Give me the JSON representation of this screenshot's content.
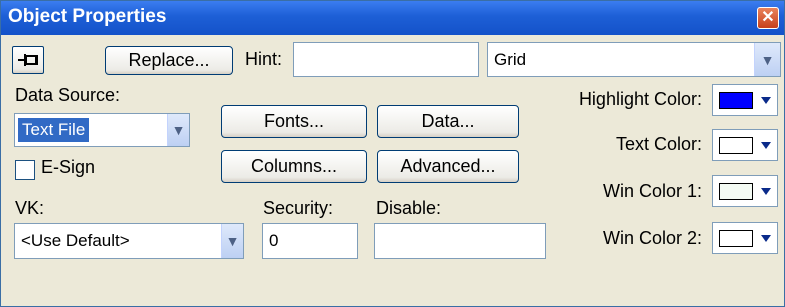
{
  "window": {
    "title": "Object Properties",
    "close_glyph": "✕"
  },
  "toolbar": {
    "replace_label": "Replace...",
    "hint_label": "Hint:",
    "hint_value": "",
    "type_value": "Grid"
  },
  "data_source": {
    "label": "Data Source:",
    "value": "Text File"
  },
  "esign": {
    "label": "E-Sign",
    "checked": false
  },
  "vk": {
    "label": "VK:",
    "value": "<Use Default>"
  },
  "security": {
    "label": "Security:",
    "value": "0"
  },
  "disable": {
    "label": "Disable:",
    "value": ""
  },
  "buttons": {
    "fonts": "Fonts...",
    "data": "Data...",
    "columns": "Columns...",
    "advanced": "Advanced..."
  },
  "colors": {
    "highlight": {
      "label": "Highlight Color:",
      "color": "#0000ff"
    },
    "text": {
      "label": "Text Color:",
      "color": "#ffffff"
    },
    "win1": {
      "label": "Win Color 1:",
      "color": "#f4fbf4"
    },
    "win2": {
      "label": "Win Color 2:",
      "color": "#ffffff"
    }
  },
  "icons": {
    "pin": "pin-icon",
    "dropdown": "chevron-down-icon",
    "close": "close-icon"
  }
}
